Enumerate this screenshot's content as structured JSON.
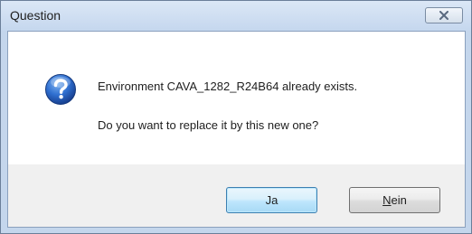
{
  "window": {
    "title": "Question"
  },
  "message": {
    "line1": "Environment CAVA_1282_R24B64 already exists.",
    "line2": "Do you want to replace it by this new one?"
  },
  "icons": {
    "question": "question-mark-icon",
    "close": "close-icon"
  },
  "buttons": {
    "yes_label": "Ja",
    "no_mnemonic": "N",
    "no_rest": "ein"
  },
  "colors": {
    "default_button_border": "#3c7fb1",
    "question_icon": "#1f5fbf"
  }
}
